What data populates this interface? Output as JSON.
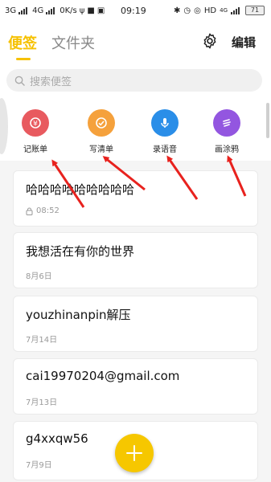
{
  "status_bar": {
    "network1": "3G",
    "network2": "4G",
    "speed": "0K/s",
    "time": "09:19",
    "hd": "HD",
    "network3": "4G",
    "battery": "71"
  },
  "header": {
    "tabs": [
      {
        "label": "便签",
        "active": true
      },
      {
        "label": "文件夹",
        "active": false
      }
    ],
    "edit_label": "编辑",
    "settings_icon": "gear-icon"
  },
  "search": {
    "placeholder": "搜索便签"
  },
  "quick_actions": [
    {
      "label": "记账单",
      "icon": "bill-icon",
      "color": "#e85a5f"
    },
    {
      "label": "写清单",
      "icon": "check-icon",
      "color": "#f5a13c"
    },
    {
      "label": "录语音",
      "icon": "microphone-icon",
      "color": "#2a8ee8"
    },
    {
      "label": "画涂鸦",
      "icon": "doodle-icon",
      "color": "#9356e0"
    }
  ],
  "notes": [
    {
      "title": "哈哈哈哈哈哈哈哈哈",
      "meta": "08:52",
      "locked": true
    },
    {
      "title": "我想活在有你的世界",
      "meta": "8月6日",
      "locked": false
    },
    {
      "title": "youzhinanpin解压",
      "meta": "7月14日",
      "locked": false
    },
    {
      "title": "cai19970204@gmail.com",
      "meta": "7月13日",
      "locked": false
    },
    {
      "title": "g4xxqw56",
      "meta": "7月9日",
      "locked": false
    }
  ],
  "colors": {
    "accent": "#f6c100",
    "annotation_arrow": "#e8221e"
  }
}
